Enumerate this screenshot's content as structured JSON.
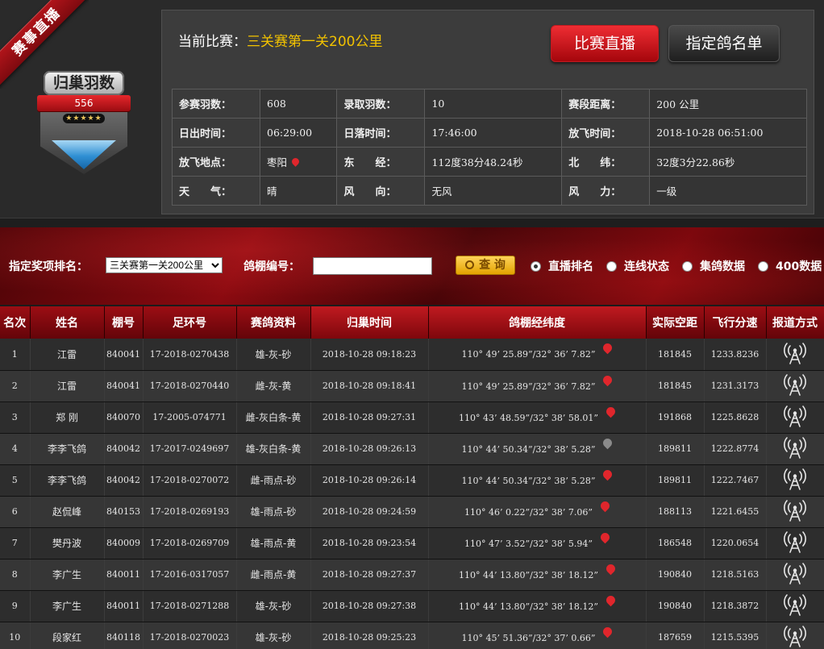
{
  "ribbon": "赛事直播",
  "badge": {
    "title": "归巢羽数",
    "count": "556",
    "stars": "★★★★★"
  },
  "match": {
    "label": "当前比赛：",
    "value": "三关赛第一关200公里"
  },
  "buttons": {
    "live": "比赛直播",
    "designated": "指定鸽名单"
  },
  "info": {
    "rows": [
      [
        {
          "k": "参赛羽数：",
          "v": "608"
        },
        {
          "k": "录取羽数：",
          "v": "10"
        },
        {
          "k": "赛段距离：",
          "v": "200 公里"
        }
      ],
      [
        {
          "k": "日出时间：",
          "v": "06:29:00"
        },
        {
          "k": "日落时间：",
          "v": "17:46:00"
        },
        {
          "k": "放飞时间：",
          "v": "2018-10-28 06:51:00"
        }
      ],
      [
        {
          "k": "放飞地点：",
          "v": "枣阳"
        },
        {
          "k": "东　　经：",
          "v": "112度38分48.24秒"
        },
        {
          "k": "北　　纬：",
          "v": "32度3分22.86秒"
        }
      ],
      [
        {
          "k": "天　　气：",
          "v": "晴"
        },
        {
          "k": "风　　向：",
          "v": "无风"
        },
        {
          "k": "风　　力：",
          "v": "一级"
        }
      ]
    ]
  },
  "search": {
    "prize_label": "指定奖项排名：",
    "prize_value": "三关赛第一关200公里",
    "loft_label": "鸽棚编号：",
    "loft_value": "",
    "query_label": "查 询",
    "radios": [
      {
        "label": "直播排名",
        "checked": true
      },
      {
        "label": "连线状态",
        "checked": false
      },
      {
        "label": "集鸽数据",
        "checked": false
      },
      {
        "label": "400数据",
        "checked": false
      }
    ]
  },
  "table": {
    "headers": [
      "名次",
      "姓名",
      "棚号",
      "足环号",
      "赛鸽资料",
      "归巢时间",
      "鸽棚经纬度",
      "实际空距",
      "飞行分速",
      "报道方式"
    ],
    "rows": [
      {
        "rank": "1",
        "name": "江雷",
        "loft": "840041",
        "ring": "17-2018-0270438",
        "info": "雄-灰-砂",
        "time": "2018-10-28 09:18:23",
        "coord": "110° 49’ 25.89”/32° 36’ 7.82”",
        "pin": "red",
        "dist": "181845",
        "speed": "1233.8236"
      },
      {
        "rank": "2",
        "name": "江雷",
        "loft": "840041",
        "ring": "17-2018-0270440",
        "info": "雌-灰-黄",
        "time": "2018-10-28 09:18:41",
        "coord": "110° 49’ 25.89”/32° 36’ 7.82”",
        "pin": "red",
        "dist": "181845",
        "speed": "1231.3173"
      },
      {
        "rank": "3",
        "name": "郑 刚",
        "loft": "840070",
        "ring": "17-2005-074771",
        "info": "雌-灰白条-黄",
        "time": "2018-10-28 09:27:31",
        "coord": "110° 43’ 48.59”/32° 38’ 58.01”",
        "pin": "red",
        "dist": "191868",
        "speed": "1225.8628"
      },
      {
        "rank": "4",
        "name": "李李飞鸽",
        "loft": "840042",
        "ring": "17-2017-0249697",
        "info": "雄-灰白条-黄",
        "time": "2018-10-28 09:26:13",
        "coord": "110° 44’ 50.34”/32° 38’ 5.28”",
        "pin": "grey",
        "dist": "189811",
        "speed": "1222.8774"
      },
      {
        "rank": "5",
        "name": "李李飞鸽",
        "loft": "840042",
        "ring": "17-2018-0270072",
        "info": "雌-雨点-砂",
        "time": "2018-10-28 09:26:14",
        "coord": "110° 44’ 50.34”/32° 38’ 5.28”",
        "pin": "red",
        "dist": "189811",
        "speed": "1222.7467"
      },
      {
        "rank": "6",
        "name": "赵侃峰",
        "loft": "840153",
        "ring": "17-2018-0269193",
        "info": "雄-雨点-砂",
        "time": "2018-10-28 09:24:59",
        "coord": "110° 46’ 0.22”/32° 38’ 7.06”",
        "pin": "red",
        "dist": "188113",
        "speed": "1221.6455"
      },
      {
        "rank": "7",
        "name": "樊丹波",
        "loft": "840009",
        "ring": "17-2018-0269709",
        "info": "雄-雨点-黄",
        "time": "2018-10-28 09:23:54",
        "coord": "110° 47’ 3.52”/32° 38’ 5.94”",
        "pin": "red",
        "dist": "186548",
        "speed": "1220.0654"
      },
      {
        "rank": "8",
        "name": "李广生",
        "loft": "840011",
        "ring": "17-2016-0317057",
        "info": "雌-雨点-黄",
        "time": "2018-10-28 09:27:37",
        "coord": "110° 44’ 13.80”/32° 38’ 18.12”",
        "pin": "red",
        "dist": "190840",
        "speed": "1218.5163"
      },
      {
        "rank": "9",
        "name": "李广生",
        "loft": "840011",
        "ring": "17-2018-0271288",
        "info": "雄-灰-砂",
        "time": "2018-10-28 09:27:38",
        "coord": "110° 44’ 13.80”/32° 38’ 18.12”",
        "pin": "red",
        "dist": "190840",
        "speed": "1218.3872"
      },
      {
        "rank": "10",
        "name": "段家红",
        "loft": "840118",
        "ring": "17-2018-0270023",
        "info": "雄-灰-砂",
        "time": "2018-10-28 09:25:23",
        "coord": "110° 45’ 51.36”/32° 37’ 0.66”",
        "pin": "red",
        "dist": "187659",
        "speed": "1215.5395"
      }
    ]
  }
}
